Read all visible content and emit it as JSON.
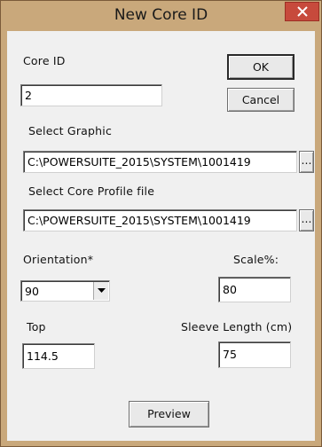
{
  "dialog": {
    "title": "New Core ID",
    "close_icon": "close-icon"
  },
  "core_id": {
    "label": "Core ID",
    "value": "2"
  },
  "buttons": {
    "ok": "OK",
    "cancel": "Cancel",
    "preview": "Preview",
    "browse_graphic": "...",
    "browse_profile": "..."
  },
  "select_graphic": {
    "label": "Select Graphic",
    "value": "C:\\POWERSUITE_2015\\SYSTEM\\1001419"
  },
  "select_profile": {
    "label": "Select Core Profile file",
    "value": "C:\\POWERSUITE_2015\\SYSTEM\\1001419"
  },
  "orientation": {
    "label": "Orientation*",
    "value": "90"
  },
  "scale": {
    "label": "Scale%:",
    "value": "80"
  },
  "top": {
    "label": "Top",
    "value": "114.5"
  },
  "sleeve": {
    "label": "Sleeve Length (cm)",
    "value": "75"
  },
  "colors": {
    "titlebar": "#c9a87b",
    "close_button": "#c74a3c",
    "client_bg": "#f0f0f0"
  }
}
